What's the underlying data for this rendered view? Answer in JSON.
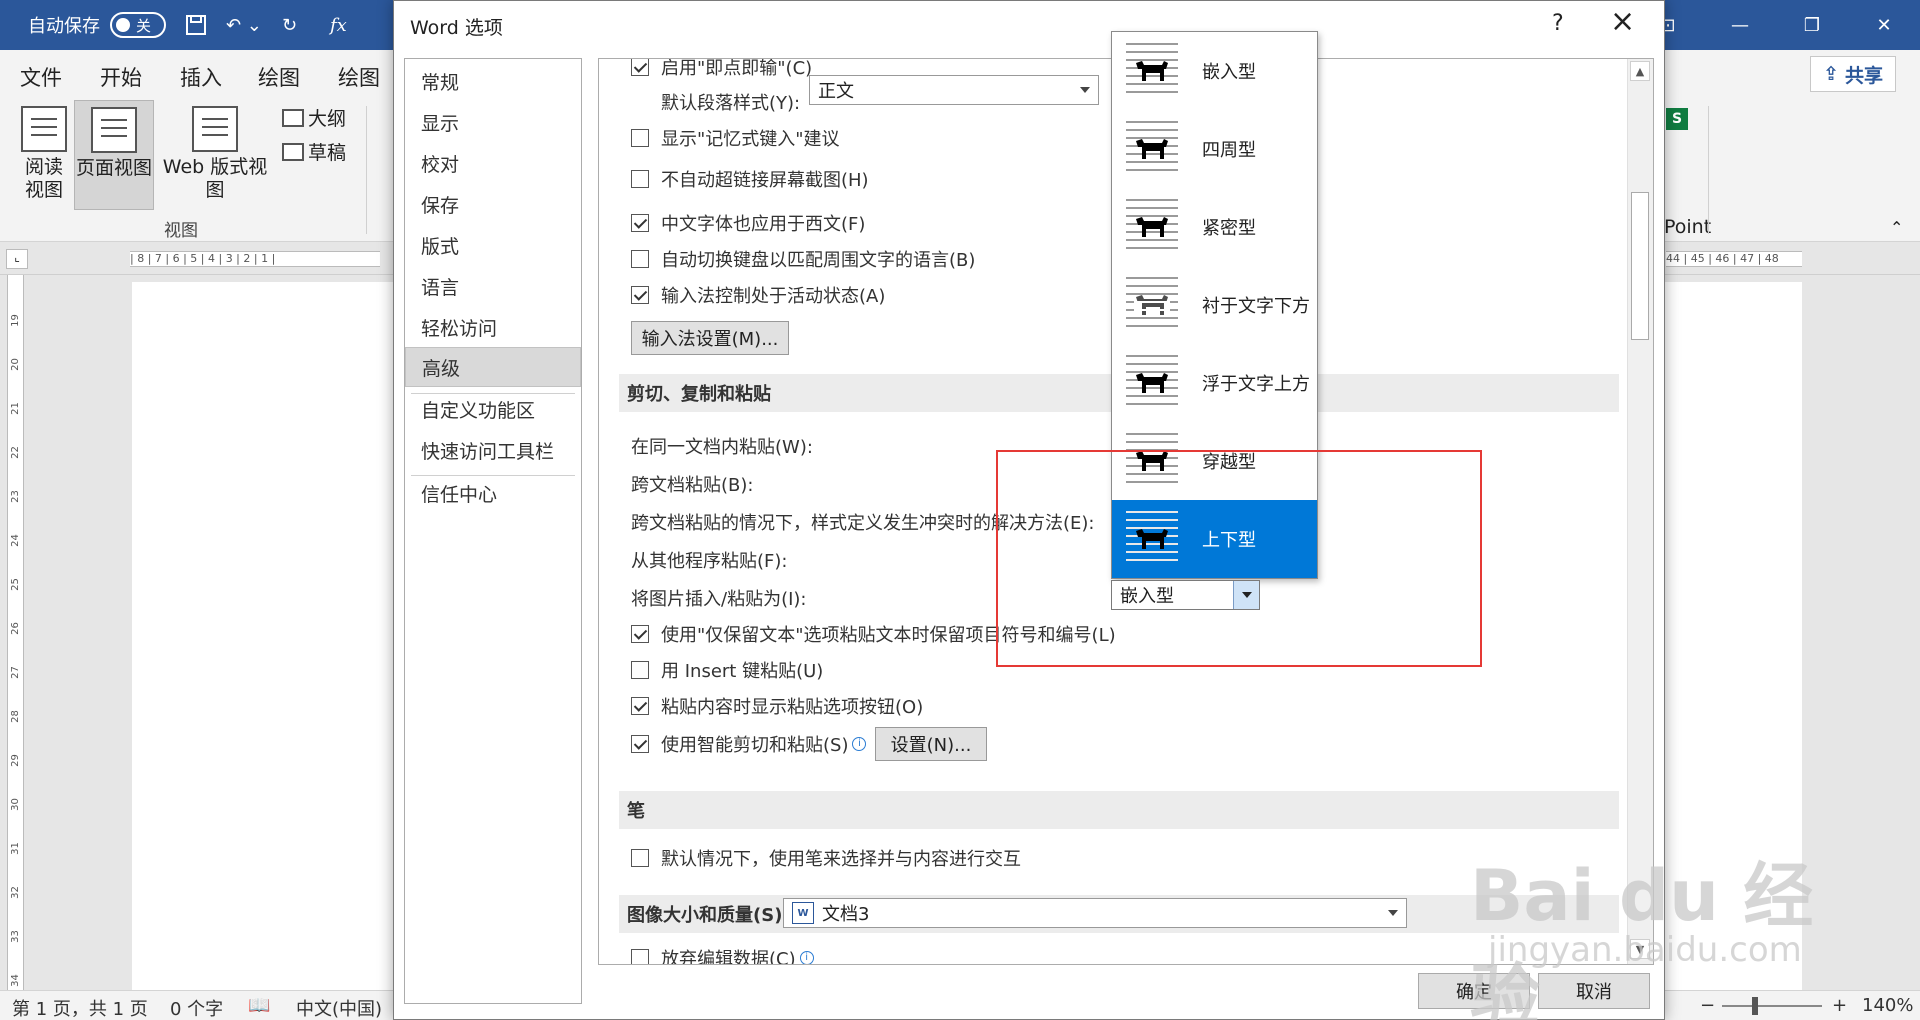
{
  "word": {
    "autosave_label": "自动保存",
    "autosave_state": "关",
    "ribbon_tabs": [
      "文件",
      "开始",
      "插入",
      "绘图",
      "绘图"
    ],
    "share_label": "共享",
    "view_buttons": {
      "read_mode": "阅读\n视图",
      "print_layout": "页面视图",
      "web_layout": "Web 版式视图",
      "outline": "大纲",
      "draft": "草稿"
    },
    "group_view": "视图",
    "ribbon_right_text": "Point",
    "ruler_text": "| 8 | 7 | 6 | 5 | 4 | 3 | 2 | 1 |",
    "ruler_right_text": "44 | 45 | 46 | 47 | 48",
    "vruler_numbers": [
      "19",
      "20",
      "21",
      "22",
      "23",
      "24",
      "25",
      "26",
      "27",
      "28",
      "29",
      "30",
      "31",
      "32",
      "33",
      "34"
    ],
    "status": {
      "page": "第 1 页，共 1 页",
      "words": "0 个字",
      "language": "中文(中国)",
      "zoom": "140%"
    }
  },
  "dialog": {
    "title": "Word 选项",
    "help": "?",
    "nav": [
      "常规",
      "显示",
      "校对",
      "保存",
      "版式",
      "语言",
      "轻松访问",
      "高级",
      "自定义功能区",
      "快速访问工具栏",
      "信任中心"
    ],
    "nav_selected": "高级",
    "editing": {
      "click_and_type": "启用\"即点即输\"(C)",
      "default_para_style_label": "默认段落样式(Y):",
      "default_para_style_value": "正文",
      "autocomplete": "显示\"记忆式键入\"建议",
      "no_auto_hyperlink": "不自动超链接屏幕截图(H)",
      "chinese_font_west": "中文字体也应用于西文(F)",
      "auto_keyboard": "自动切换键盘以匹配周围文字的语言(B)",
      "ime_active": "输入法控制处于活动状态(A)",
      "ime_settings_btn": "输入法设置(M)..."
    },
    "cut_copy_paste": {
      "header": "剪切、复制和粘贴",
      "within_doc": "在同一文档内粘贴(W):",
      "between_docs": "跨文档粘贴(B):",
      "style_conflict": "跨文档粘贴的情况下，样式定义发生冲突时的解决方法(E):",
      "from_other": "从其他程序粘贴(F):",
      "insert_pictures_as": "将图片插入/粘贴为(I):",
      "keep_bullets": "使用\"仅保留文本\"选项粘贴文本时保留项目符号和编号(L)",
      "insert_key": "用 Insert 键粘贴(U)",
      "show_paste_options": "粘贴内容时显示粘贴选项按钮(O)",
      "smart_cut": "使用智能剪切和粘贴(S)",
      "settings_btn": "设置(N)..."
    },
    "pen": {
      "header": "笔",
      "default_pen": "默认情况下，使用笔来选择并与内容进行交互"
    },
    "image_quality": {
      "header": "图像大小和质量(S)",
      "document": "文档3",
      "discard_edit": "放弃编辑数据(C)"
    },
    "ok": "确定",
    "cancel": "取消"
  },
  "wrap_dropdown": {
    "items": [
      "嵌入型",
      "四周型",
      "紧密型",
      "衬于文字下方",
      "浮于文字上方",
      "穿越型",
      "上下型"
    ],
    "highlighted": "上下型",
    "current_value": "嵌入型"
  },
  "watermark": {
    "brand": "Bai du 经验",
    "url": "jingyan.baidu.com"
  },
  "colors": {
    "word_blue": "#2b579a",
    "selection_blue": "#0078d7",
    "highlight_red": "#e53935"
  }
}
